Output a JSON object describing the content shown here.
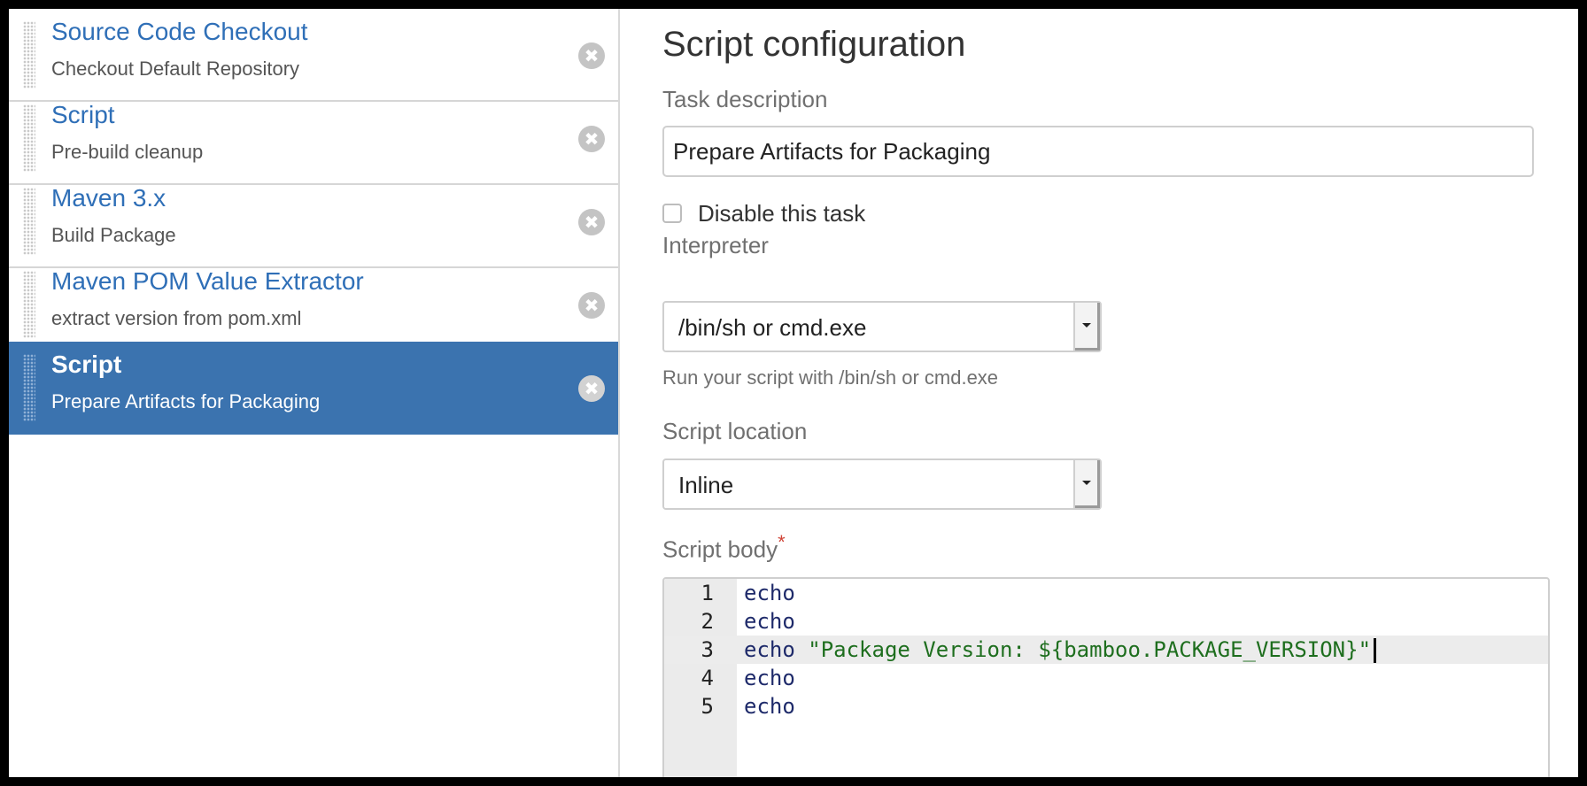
{
  "tasks": [
    {
      "title": "Source Code Checkout",
      "subtitle": "Checkout Default Repository",
      "selected": false
    },
    {
      "title": "Script",
      "subtitle": "Pre-build cleanup",
      "selected": false
    },
    {
      "title": "Maven 3.x",
      "subtitle": "Build Package",
      "selected": false
    },
    {
      "title": "Maven POM Value Extractor",
      "subtitle": "extract version from pom.xml",
      "selected": false
    },
    {
      "title": "Script",
      "subtitle": "Prepare Artifacts for Packaging",
      "selected": true
    }
  ],
  "remove_icon": "✖",
  "config": {
    "title": "Script configuration",
    "task_description_label": "Task description",
    "task_description_value": "Prepare Artifacts for Packaging",
    "disable_label": "Disable this task",
    "disable_checked": false,
    "interpreter_label": "Interpreter",
    "interpreter_value": "/bin/sh or cmd.exe",
    "interpreter_help": "Run your script with /bin/sh or cmd.exe",
    "script_location_label": "Script location",
    "script_location_value": "Inline",
    "script_body_label": "Script body",
    "required_mark": "*"
  },
  "editor": {
    "active_line": 3,
    "lines": [
      {
        "number": "1",
        "keyword": "echo",
        "string": ""
      },
      {
        "number": "2",
        "keyword": "echo",
        "string": ""
      },
      {
        "number": "3",
        "keyword": "echo",
        "string": " \"Package Version: ${bamboo.PACKAGE_VERSION}\""
      },
      {
        "number": "4",
        "keyword": "echo",
        "string": ""
      },
      {
        "number": "5",
        "keyword": "echo",
        "string": ""
      }
    ]
  },
  "colors": {
    "selected_background": "#3b73af",
    "link_blue": "#2f6fb7",
    "string_green": "#1e6e1e",
    "required_red": "#d04437"
  }
}
